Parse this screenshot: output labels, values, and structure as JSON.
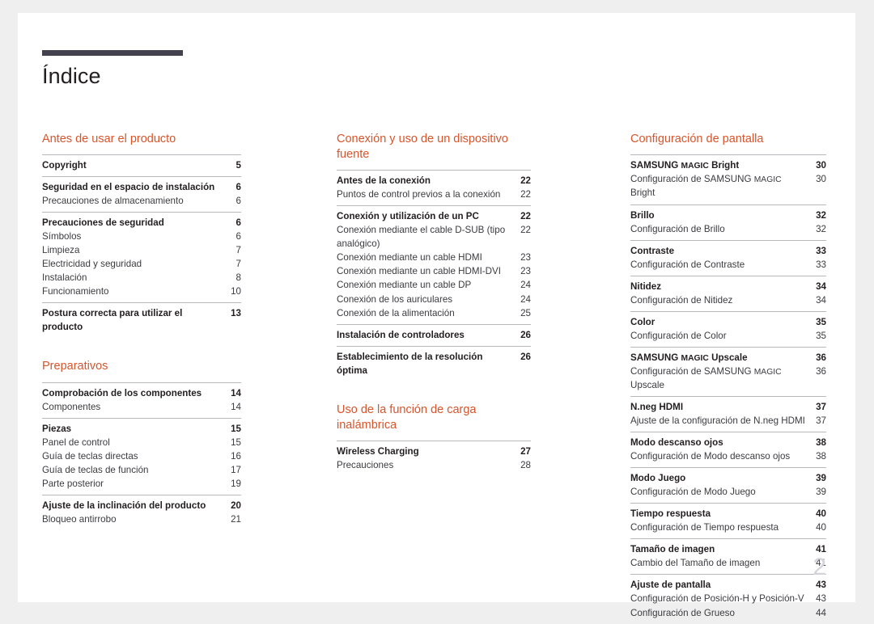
{
  "title": "Índice",
  "page_number": "2",
  "accent_color": "#d9542b",
  "rule_color": "#42414d",
  "columns": [
    {
      "name": "column-left",
      "sections": [
        {
          "heading": "Antes de usar el producto",
          "groups": [
            {
              "entries": [
                {
                  "level": "primary",
                  "label": "Copyright",
                  "page": "5"
                }
              ]
            },
            {
              "entries": [
                {
                  "level": "primary",
                  "label": "Seguridad en el espacio de instalación",
                  "page": "6"
                },
                {
                  "level": "sub",
                  "label": "Precauciones de almacenamiento",
                  "page": "6"
                }
              ]
            },
            {
              "entries": [
                {
                  "level": "primary",
                  "label": "Precauciones de seguridad",
                  "page": "6"
                },
                {
                  "level": "sub",
                  "label": "Símbolos",
                  "page": "6"
                },
                {
                  "level": "sub",
                  "label": "Limpieza",
                  "page": "7"
                },
                {
                  "level": "sub",
                  "label": "Electricidad y seguridad",
                  "page": "7"
                },
                {
                  "level": "sub",
                  "label": "Instalación",
                  "page": "8"
                },
                {
                  "level": "sub",
                  "label": "Funcionamiento",
                  "page": "10"
                }
              ]
            },
            {
              "entries": [
                {
                  "level": "primary",
                  "label": "Postura correcta para utilizar el producto",
                  "page": "13"
                }
              ]
            }
          ]
        },
        {
          "heading": "Preparativos",
          "groups": [
            {
              "entries": [
                {
                  "level": "primary",
                  "label": "Comprobación de los componentes",
                  "page": "14"
                },
                {
                  "level": "sub",
                  "label": "Componentes",
                  "page": "14"
                }
              ]
            },
            {
              "entries": [
                {
                  "level": "primary",
                  "label": "Piezas",
                  "page": "15"
                },
                {
                  "level": "sub",
                  "label": "Panel de control",
                  "page": "15"
                },
                {
                  "level": "sub",
                  "label": "Guía de teclas directas",
                  "page": "16"
                },
                {
                  "level": "sub",
                  "label": "Guía de teclas de función",
                  "page": "17"
                },
                {
                  "level": "sub",
                  "label": "Parte posterior",
                  "page": "19"
                }
              ]
            },
            {
              "entries": [
                {
                  "level": "primary",
                  "label": "Ajuste de la inclinación del producto",
                  "page": "20"
                },
                {
                  "level": "sub",
                  "label": "Bloqueo antirrobo",
                  "page": "21"
                }
              ]
            }
          ]
        }
      ]
    },
    {
      "name": "column-middle",
      "sections": [
        {
          "heading": "Conexión y uso de un dispositivo fuente",
          "groups": [
            {
              "entries": [
                {
                  "level": "primary",
                  "label": "Antes de la conexión",
                  "page": "22"
                },
                {
                  "level": "sub",
                  "label": "Puntos de control previos a la conexión",
                  "page": "22"
                }
              ]
            },
            {
              "entries": [
                {
                  "level": "primary",
                  "label": "Conexión y utilización de un PC",
                  "page": "22"
                },
                {
                  "level": "sub",
                  "label": "Conexión mediante el cable D-SUB (tipo analógico)",
                  "page": "22",
                  "wrapped": true
                },
                {
                  "level": "sub",
                  "label": "Conexión mediante un cable HDMI",
                  "page": "23"
                },
                {
                  "level": "sub",
                  "label": "Conexión mediante un cable HDMI-DVI",
                  "page": "23"
                },
                {
                  "level": "sub",
                  "label": "Conexión mediante un cable DP",
                  "page": "24"
                },
                {
                  "level": "sub",
                  "label": "Conexión de los auriculares",
                  "page": "24"
                },
                {
                  "level": "sub",
                  "label": "Conexión de la alimentación",
                  "page": "25"
                }
              ]
            },
            {
              "entries": [
                {
                  "level": "primary",
                  "label": "Instalación de controladores",
                  "page": "26"
                }
              ]
            },
            {
              "entries": [
                {
                  "level": "primary",
                  "label": "Establecimiento de la resolución óptima",
                  "page": "26"
                }
              ]
            }
          ]
        },
        {
          "heading": "Uso de la función de carga inalámbrica",
          "groups": [
            {
              "entries": [
                {
                  "level": "primary",
                  "label": "Wireless Charging",
                  "page": "27"
                },
                {
                  "level": "sub",
                  "label": "Precauciones",
                  "page": "28"
                }
              ]
            }
          ]
        }
      ]
    },
    {
      "name": "column-right",
      "sections": [
        {
          "heading": "Configuración de pantalla",
          "groups": [
            {
              "entries": [
                {
                  "level": "primary",
                  "label": "SAMSUNG MAGIC Bright",
                  "page": "30",
                  "magic": true
                },
                {
                  "level": "sub",
                  "label": "Configuración de SAMSUNG MAGIC Bright",
                  "page": "30",
                  "magic": true
                }
              ]
            },
            {
              "entries": [
                {
                  "level": "primary",
                  "label": "Brillo",
                  "page": "32"
                },
                {
                  "level": "sub",
                  "label": "Configuración de Brillo",
                  "page": "32"
                }
              ]
            },
            {
              "entries": [
                {
                  "level": "primary",
                  "label": "Contraste",
                  "page": "33"
                },
                {
                  "level": "sub",
                  "label": "Configuración de Contraste",
                  "page": "33"
                }
              ]
            },
            {
              "entries": [
                {
                  "level": "primary",
                  "label": "Nitidez",
                  "page": "34"
                },
                {
                  "level": "sub",
                  "label": "Configuración de Nitidez",
                  "page": "34"
                }
              ]
            },
            {
              "entries": [
                {
                  "level": "primary",
                  "label": "Color",
                  "page": "35"
                },
                {
                  "level": "sub",
                  "label": "Configuración de Color",
                  "page": "35"
                }
              ]
            },
            {
              "entries": [
                {
                  "level": "primary",
                  "label": "SAMSUNG MAGIC Upscale",
                  "page": "36",
                  "magic": true
                },
                {
                  "level": "sub",
                  "label": "Configuración de SAMSUNG MAGIC Upscale",
                  "page": "36",
                  "magic": true
                }
              ]
            },
            {
              "entries": [
                {
                  "level": "primary",
                  "label": "N.neg HDMI",
                  "page": "37"
                },
                {
                  "level": "sub",
                  "label": "Ajuste de la configuración de N.neg HDMI",
                  "page": "37"
                }
              ]
            },
            {
              "entries": [
                {
                  "level": "primary",
                  "label": "Modo descanso ojos",
                  "page": "38"
                },
                {
                  "level": "sub",
                  "label": "Configuración de Modo descanso ojos",
                  "page": "38"
                }
              ]
            },
            {
              "entries": [
                {
                  "level": "primary",
                  "label": "Modo Juego",
                  "page": "39"
                },
                {
                  "level": "sub",
                  "label": "Configuración de Modo Juego",
                  "page": "39"
                }
              ]
            },
            {
              "entries": [
                {
                  "level": "primary",
                  "label": "Tiempo respuesta",
                  "page": "40"
                },
                {
                  "level": "sub",
                  "label": "Configuración de Tiempo respuesta",
                  "page": "40"
                }
              ]
            },
            {
              "entries": [
                {
                  "level": "primary",
                  "label": "Tamaño de imagen",
                  "page": "41"
                },
                {
                  "level": "sub",
                  "label": "Cambio del Tamaño de imagen",
                  "page": "41"
                }
              ]
            },
            {
              "entries": [
                {
                  "level": "primary",
                  "label": "Ajuste de pantalla",
                  "page": "43"
                },
                {
                  "level": "sub",
                  "label": "Configuración de Posición-H y Posición-V",
                  "page": "43"
                },
                {
                  "level": "sub",
                  "label": "Configuración de Grueso",
                  "page": "44"
                }
              ]
            }
          ]
        }
      ]
    }
  ]
}
